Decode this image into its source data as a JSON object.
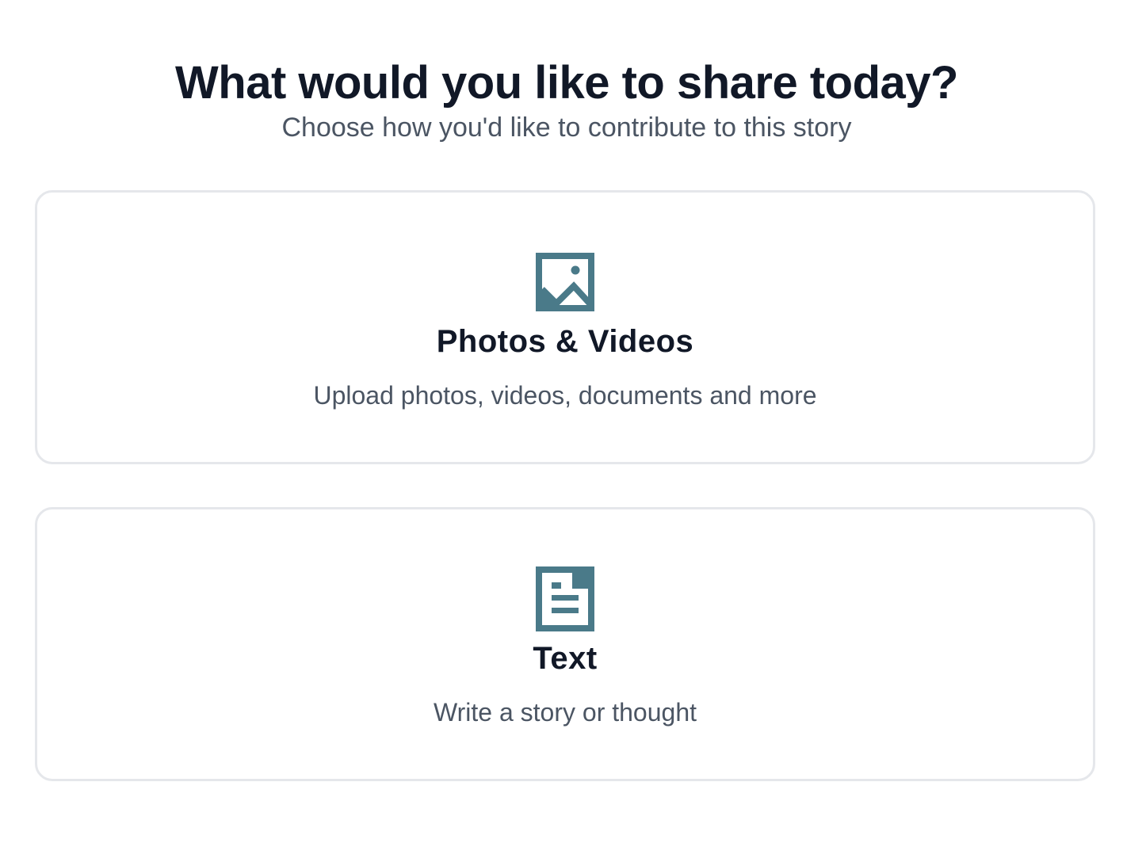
{
  "header": {
    "title": "What would you like to share today?",
    "subtitle": "Choose how you'd like to contribute to this story"
  },
  "options": [
    {
      "icon": "image-icon",
      "title": "Photos & Videos",
      "description": "Upload photos, videos, documents and more"
    },
    {
      "icon": "document-icon",
      "title": "Text",
      "description": "Write a story or thought"
    }
  ],
  "colors": {
    "icon": "#4a7a89",
    "title": "#111827",
    "text": "#4b5563",
    "border": "#e5e7eb"
  }
}
